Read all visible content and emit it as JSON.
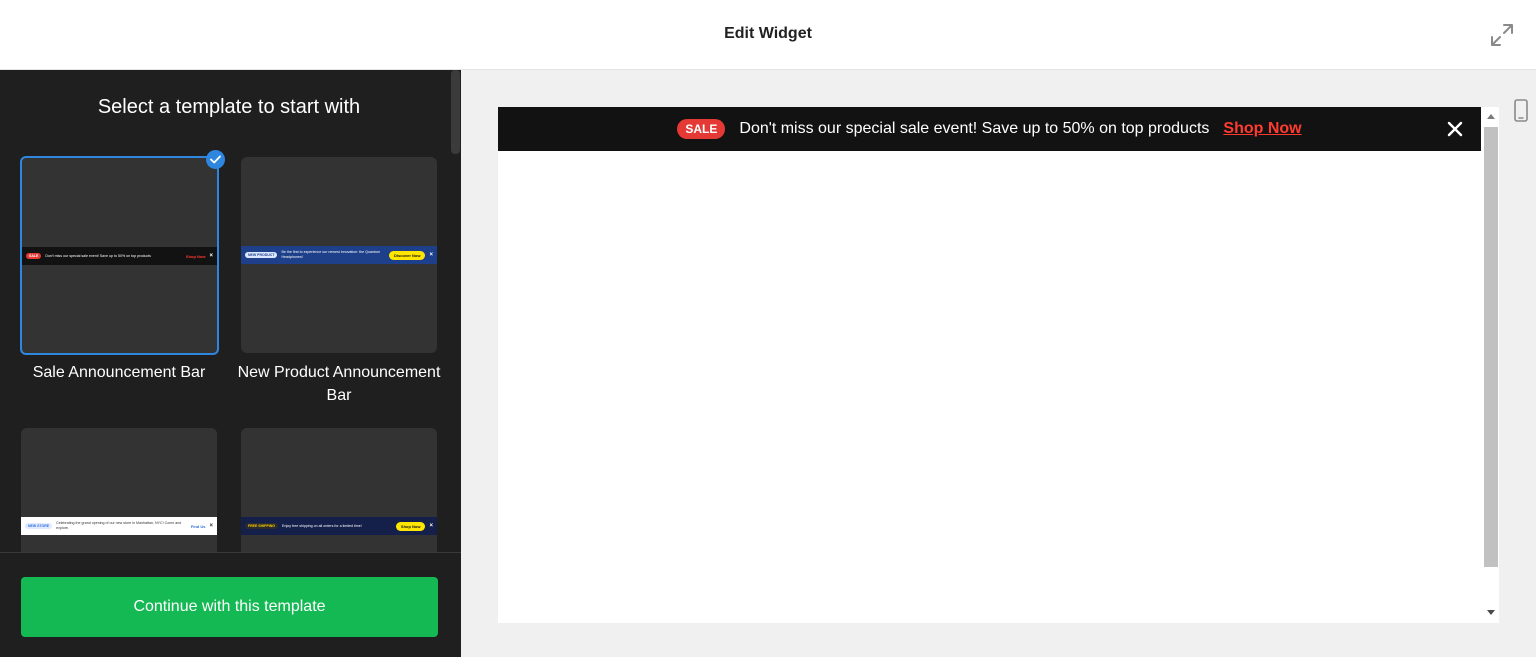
{
  "header": {
    "title": "Edit Widget"
  },
  "left_panel": {
    "title": "Select a template to start with",
    "templates": [
      {
        "label": "Sale Announcement Bar",
        "selected": true,
        "mini": {
          "bg": "#121212",
          "pill": "SALE",
          "pill_bg": "#e53935",
          "pill_fg": "#ffffff",
          "text": "Don't miss our special sale event! Save up to 50% on top products",
          "text_color": "#ffffff",
          "cta": "Shop Now",
          "cta_color": "#ff3b30"
        }
      },
      {
        "label": "New Product Announcement Bar",
        "selected": false,
        "mini": {
          "bg": "#1e3f8a",
          "pill": "NEW PRODUCT",
          "pill_bg": "#dde6ff",
          "pill_fg": "#1e3f8a",
          "text": "Be the first to experience our newest innovation: the Quantum Headphones!",
          "text_color": "#ffffff",
          "cta": "Discover Now",
          "cta_bg": "#ffe600",
          "cta_fg": "#111111"
        }
      },
      {
        "label": "",
        "selected": false,
        "mini": {
          "bg": "#ffffff",
          "pill": "NEW STORE",
          "pill_bg": "#e1ebff",
          "pill_fg": "#2e6ee0",
          "text": "Celebrating the grand opening of our new store in Manhattan, NYC! Come and explore.",
          "text_color": "#333333",
          "cta": "Find Us",
          "cta_color": "#2e6ee0"
        }
      },
      {
        "label": "",
        "selected": false,
        "mini": {
          "bg": "#14204a",
          "pill": "FREE SHIPPING",
          "pill_bg": "#2b2b2b",
          "pill_fg": "#ffd000",
          "text": "Enjoy free shipping on all orders for a limited time!",
          "text_color": "#ffffff",
          "cta": "Shop Now",
          "cta_bg": "#ffe600",
          "cta_fg": "#111111"
        }
      }
    ],
    "continue_label": "Continue with this template"
  },
  "preview": {
    "sale_pill": "SALE",
    "message": "Don't miss our special sale event! Save up to 50% on top products",
    "cta": "Shop Now"
  },
  "colors": {
    "accent_green": "#14b953",
    "selected_blue": "#2e86de",
    "sale_red": "#e53935"
  }
}
